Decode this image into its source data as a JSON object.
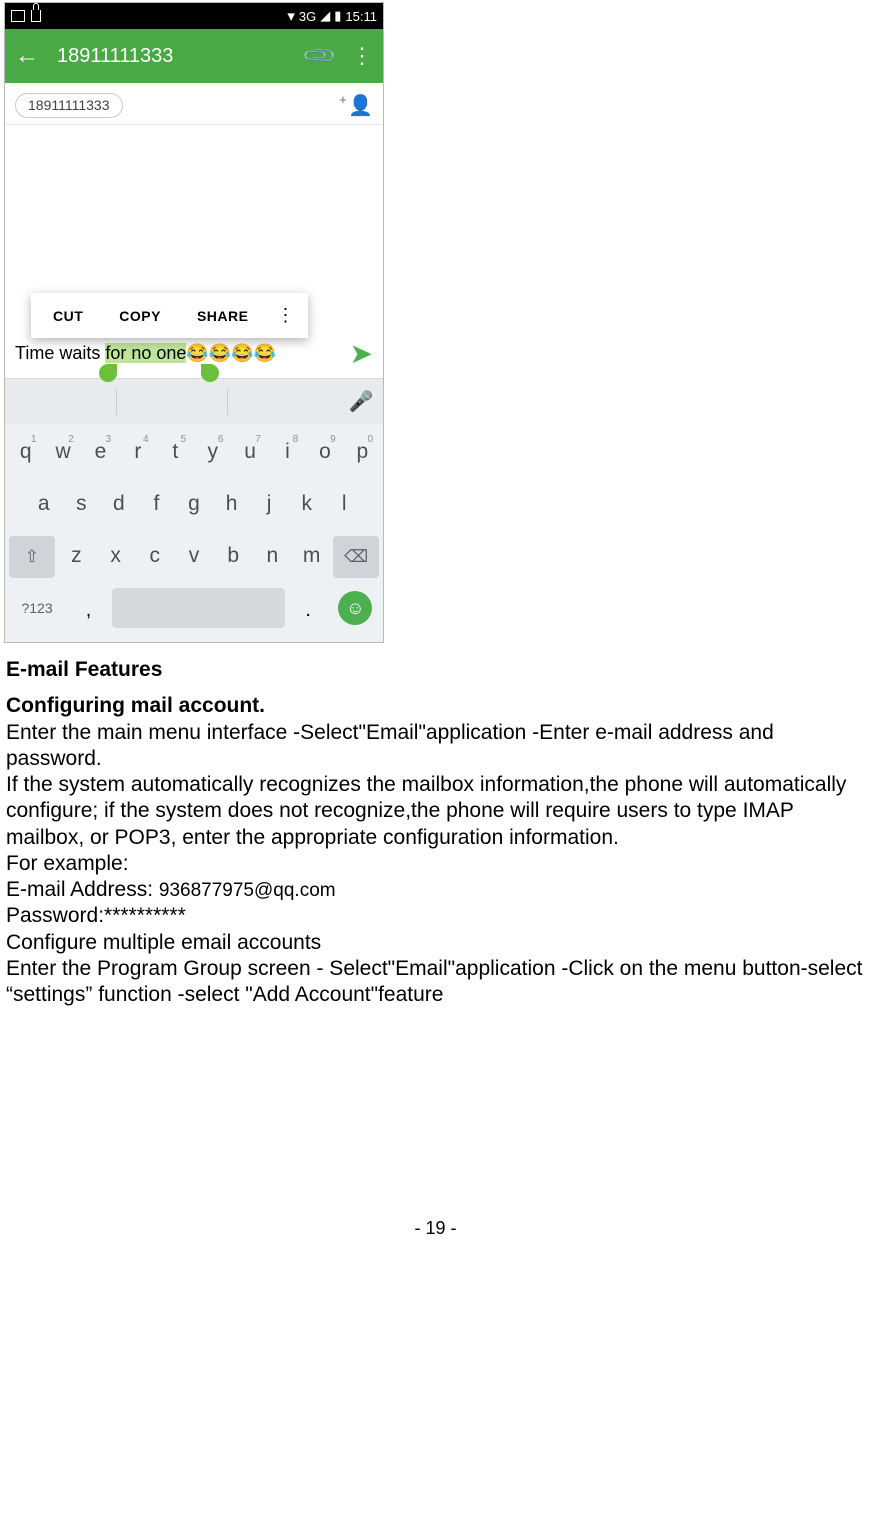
{
  "statusbar": {
    "network": "3G",
    "time": "15:11"
  },
  "appbar": {
    "title": "18911111333"
  },
  "chip": {
    "recipient": "18911111333"
  },
  "context_menu": {
    "cut": "CUT",
    "copy": "COPY",
    "share": "SHARE"
  },
  "compose": {
    "prefix": "Time waits ",
    "selected": "for no one",
    "emojis": "😂😂😂😂"
  },
  "keyboard": {
    "row1": [
      "q",
      "w",
      "e",
      "r",
      "t",
      "y",
      "u",
      "i",
      "o",
      "p"
    ],
    "row1_sup": [
      "1",
      "2",
      "3",
      "4",
      "5",
      "6",
      "7",
      "8",
      "9",
      "0"
    ],
    "row2": [
      "a",
      "s",
      "d",
      "f",
      "g",
      "h",
      "j",
      "k",
      "l"
    ],
    "row3": [
      "z",
      "x",
      "c",
      "v",
      "b",
      "n",
      "m"
    ],
    "symbols": "?123",
    "comma": ",",
    "dot": "."
  },
  "doc": {
    "h1": "E-mail Features",
    "h2": "Configuring mail account.",
    "p1": "Enter the main menu interface -Select\"Email\"application -Enter e-mail address and password.",
    "p2": "If the system automatically recognizes the mailbox information,the phone will automatically configure; if the system does not recognize,the phone will require users to type IMAP mailbox, or POP3, enter the appropriate configuration information.",
    "p3": "For example:",
    "p4_label": "E-mail Address: ",
    "p4_value": "936877975@qq.com",
    "p5": "Password:**********",
    "p6": "Configure multiple email accounts",
    "p7": "Enter the Program Group screen - Select\"Email\"application -Click on the menu button-select “settings” function -select \"Add Account\"feature",
    "page": "- 19 -"
  }
}
